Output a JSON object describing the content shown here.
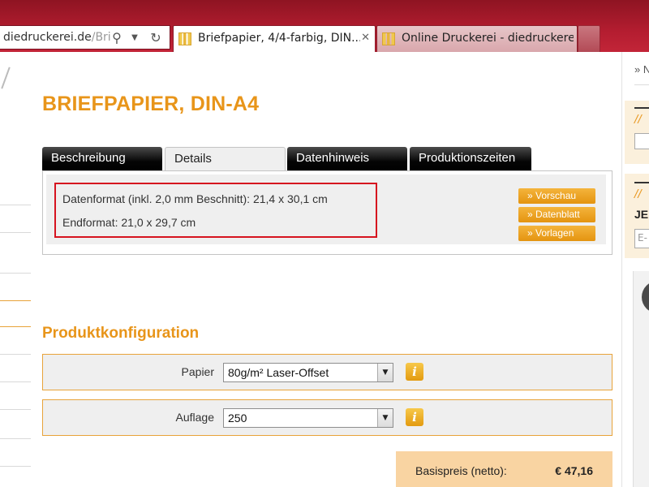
{
  "browser": {
    "address_domain": "diedruckerei.de",
    "address_rest": "/Bri",
    "tabs": [
      {
        "label": "Briefpapier, 4/4-farbig, DIN...",
        "active": true
      },
      {
        "label": "Online Druckerei - diedruckerei...",
        "active": false
      }
    ],
    "close_glyph": "✕"
  },
  "sidebar_right": {
    "link_text": "» N",
    "slashes_1": "//",
    "slashes_2": "//",
    "label_je": "JE",
    "input_placeholder": "E-"
  },
  "product": {
    "title": "BRIEFPAPIER, DIN-A4",
    "tabs": [
      "Beschreibung",
      "Details",
      "Datenhinweis",
      "Produktionszeiten"
    ],
    "active_tab": "Details",
    "details": {
      "line1": "Datenformat (inkl. 2,0 mm Beschnitt): 21,4 x 30,1 cm",
      "line2": "Endformat: 21,0 x 29,7 cm"
    },
    "buttons": [
      "» Vorschau",
      "» Datenblatt",
      "» Vorlagen"
    ]
  },
  "config": {
    "title": "Produktkonfiguration",
    "rows": [
      {
        "label": "Papier",
        "value": "80g/m² Laser-Offset"
      },
      {
        "label": "Auflage",
        "value": "250"
      }
    ],
    "info_glyph": "i",
    "select_arrow": "▼"
  },
  "price": {
    "label": "Basispreis (netto):",
    "value": "€ 47,16"
  },
  "colors": {
    "accent_orange": "#e8951a",
    "browser_red": "#b41d30",
    "highlight_red": "#d6131f"
  }
}
